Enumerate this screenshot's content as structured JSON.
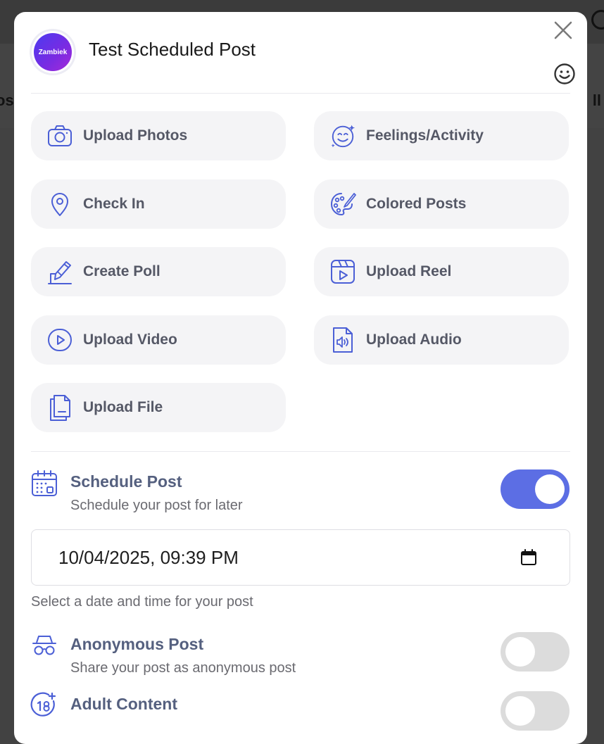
{
  "modal": {
    "avatar_text": "Zambiek",
    "title": "Test Scheduled Post"
  },
  "options": [
    {
      "label": "Upload Photos",
      "icon": "camera-icon"
    },
    {
      "label": "Feelings/Activity",
      "icon": "emoji-icon"
    },
    {
      "label": "Check In",
      "icon": "location-pin-icon"
    },
    {
      "label": "Colored Posts",
      "icon": "palette-icon"
    },
    {
      "label": "Create Poll",
      "icon": "poll-pen-icon"
    },
    {
      "label": "Upload Reel",
      "icon": "reel-icon"
    },
    {
      "label": "Upload Video",
      "icon": "video-play-icon"
    },
    {
      "label": "Upload Audio",
      "icon": "audio-file-icon"
    },
    {
      "label": "Upload File",
      "icon": "file-icon"
    }
  ],
  "schedule": {
    "title": "Schedule Post",
    "subtitle": "Schedule your post for later",
    "enabled": true,
    "datetime_value": "10/04/2025, 09:39 PM",
    "help_text": "Select a date and time for your post"
  },
  "anonymous": {
    "title": "Anonymous Post",
    "subtitle": "Share your post as anonymous post",
    "enabled": false
  },
  "adult": {
    "title": "Adult Content",
    "enabled": false
  },
  "background": {
    "left_text": "os",
    "right_text": "ll"
  },
  "colors": {
    "accent": "#5c6ee4",
    "icon_blue": "#4b5fd6",
    "toggle_off": "#dcdcdc"
  }
}
